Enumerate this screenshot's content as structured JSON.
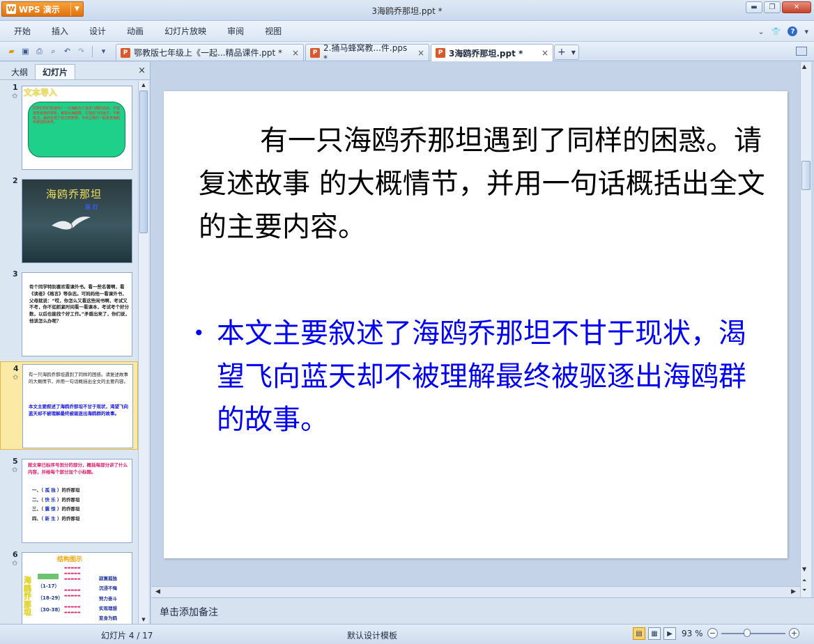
{
  "app": {
    "brand": "WPS 演示",
    "brand_logo": "W",
    "window_title": "3海鸥乔那坦.ppt *"
  },
  "menu": [
    "开始",
    "插入",
    "设计",
    "动画",
    "幻灯片放映",
    "审阅",
    "视图"
  ],
  "doc_tabs": [
    {
      "label": "鄂教版七年级上《一起...精品课件.ppt *",
      "close": "×",
      "active": false
    },
    {
      "label": "2.捅马蜂窝教...件.pps *",
      "close": "×",
      "active": false
    },
    {
      "label": "3海鸥乔那坦.ppt *",
      "close": "×",
      "active": true
    }
  ],
  "left_panel": {
    "tab_outline": "大纲",
    "tab_slides": "幻灯片",
    "close": "×",
    "thumbnails": [
      {
        "num": "1",
        "star": "✩",
        "title": "文本导入",
        "body": "同学们你们知道吗？一只海鸥为了追求飞翔的自由，不惜违背家族的规矩，被逐出海鸥群。它独自飞向远方，不断练习，最终实现了自己的梦想。今天让我们一起走进海鸥乔那坦的世界。"
      },
      {
        "num": "2",
        "star": "",
        "title": "海鸥乔那坦",
        "subtitle": "巫 灯"
      },
      {
        "num": "3",
        "star": "✩",
        "body": "有个同学特别喜欢看课外书。看一些名著啊，看《读者》《格言》等杂志。可妈妈他一看课外书，父母就说：“哎，你怎么又看这些闲书啊，考试又不考，你不如抓紧时间看一看课本，考试考个好分数，以后也能找个好工作。”矛盾出来了，你们说，他该怎么办呢？"
      },
      {
        "num": "4",
        "star": "✩",
        "para": "有一只海鸥乔那坦遇到了同样的困惑。请复述故事 的大概情节，并用一句话概括出全文的主要内容。",
        "bullet": "本文主要叙述了海鸥乔那坦不甘于现状，渴望飞向蓝天却不被理解最终被驱逐出海鸥群的故事。"
      },
      {
        "num": "5",
        "star": "✩",
        "head": "按文章已标序号划分的部分，概括每部分讲了什么内容，并给每个部分加个小标题。",
        "rows": [
          {
            "pre": "一、（",
            "word": "孤 独",
            "post": "）的乔那坦"
          },
          {
            "pre": "二、（",
            "word": "快 乐",
            "post": "）的乔那坦"
          },
          {
            "pre": "三、（",
            "word": "震 惊",
            "post": "）的乔那坦"
          },
          {
            "pre": "四、（",
            "word": "新 生",
            "post": "）的乔那坦"
          }
        ]
      },
      {
        "num": "6",
        "star": "✩",
        "title": "结构图示",
        "side": "海鸥乔那坦",
        "ranges": [
          "（1-17）",
          "（18-29）",
          "（30-38）"
        ],
        "labels": [
          "寂寞孤独",
          "沉浸不悔",
          "努力奋斗",
          "实现理想",
          "变身为鸥"
        ]
      }
    ]
  },
  "slide": {
    "paragraph": "有一只海鸥乔那坦遇到了同样的困惑。请复述故事 的大概情节，并用一句话概括出全文的主要内容。",
    "bullet_marker": "•",
    "bullet_text": "本文主要叙述了海鸥乔那坦不甘于现状，渴望飞向蓝天却不被理解最终被驱逐出海鸥群的故事。"
  },
  "notes_placeholder": "单击添加备注",
  "status": {
    "slide_counter": "幻灯片 4 / 17",
    "theme": "默认设计模板",
    "zoom": "93 %",
    "zoom_fraction": 0.4
  },
  "colors": {
    "slide_text": "#000000",
    "bullet_text": "#0000ee",
    "selected_thumb": "#fbe9a6",
    "brand_orange": "#e0720f"
  }
}
